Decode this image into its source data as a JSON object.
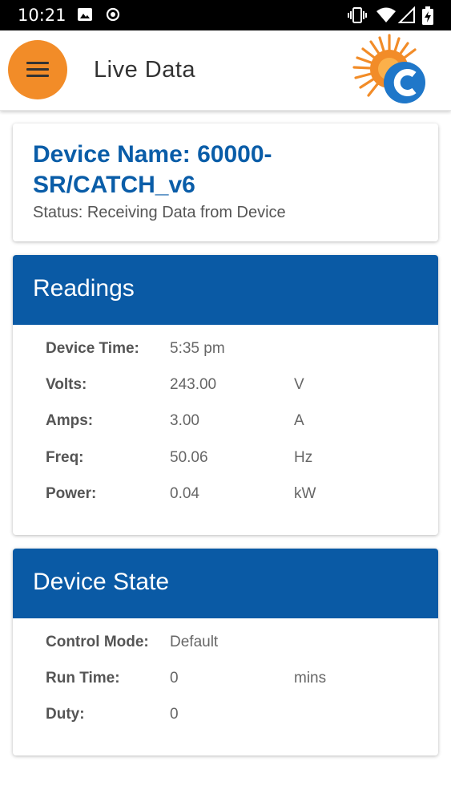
{
  "status_bar": {
    "time": "10:21"
  },
  "app_bar": {
    "title": "Live Data",
    "menu_icon": "hamburger-menu-icon",
    "logo_icon": "sun-c-logo-icon",
    "menu_color": "#f28c28"
  },
  "device": {
    "name": "Device Name: 60000-SR/CATCH_v6",
    "status": "Status: Receiving Data from Device"
  },
  "readings": {
    "title": "Readings",
    "rows": [
      {
        "label": "Device Time:",
        "value": "5:35 pm",
        "unit": ""
      },
      {
        "label": "Volts:",
        "value": "243.00",
        "unit": "V"
      },
      {
        "label": "Amps:",
        "value": "3.00",
        "unit": "A"
      },
      {
        "label": "Freq:",
        "value": "50.06",
        "unit": "Hz"
      },
      {
        "label": "Power:",
        "value": "0.04",
        "unit": "kW"
      }
    ]
  },
  "device_state": {
    "title": "Device State",
    "rows": [
      {
        "label": "Control Mode:",
        "value": "Default",
        "unit": ""
      },
      {
        "label": "Run Time:",
        "value": "0",
        "unit": "mins"
      },
      {
        "label": "Duty:",
        "value": "0",
        "unit": ""
      }
    ]
  },
  "colors": {
    "header_blue": "#0a5aa5",
    "device_name_blue": "#0a5da8",
    "accent_orange": "#f28c28"
  }
}
